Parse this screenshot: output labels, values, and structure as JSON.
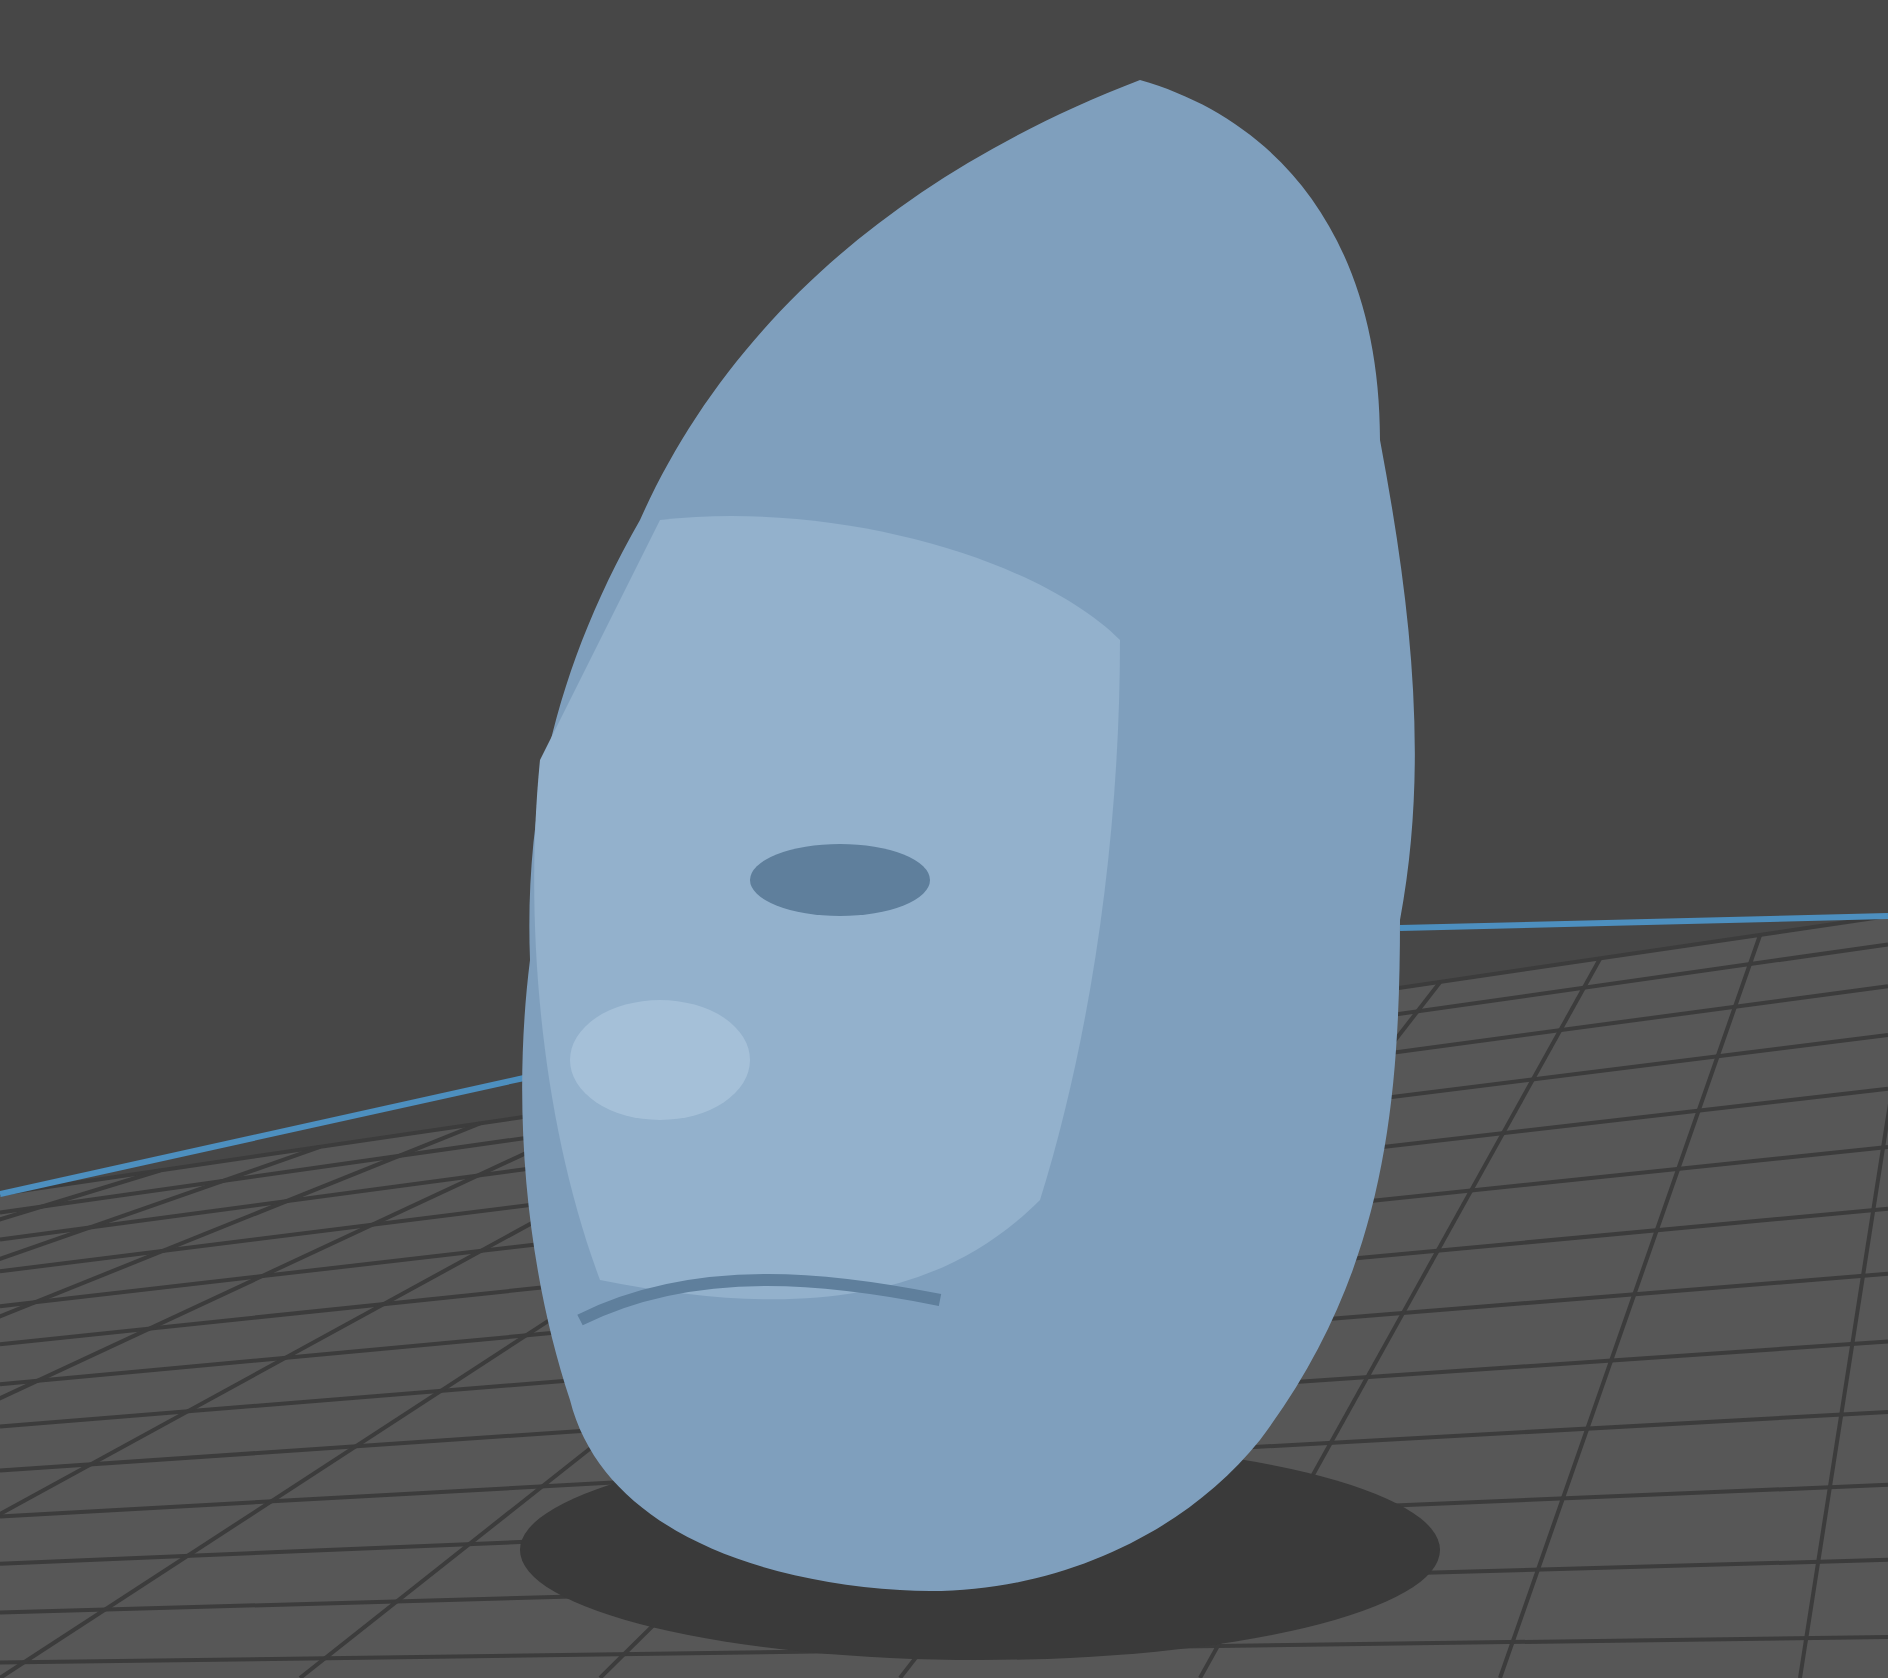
{
  "viewport": {
    "show_grid": true,
    "model": {
      "kind": "mesh"
    }
  }
}
